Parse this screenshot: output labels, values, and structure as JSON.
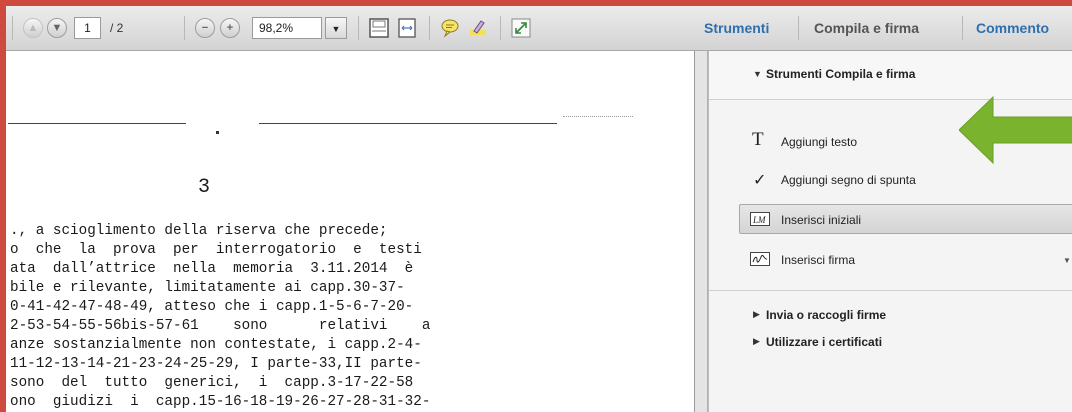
{
  "toolbar": {
    "page_current": "1",
    "page_total": "/ 2",
    "zoom": "98,2%"
  },
  "tabs": [
    {
      "label": "Strumenti",
      "color": "#2f6fae"
    },
    {
      "label": "Compila e firma",
      "color": "#555555"
    },
    {
      "label": "Commento",
      "color": "#2f6fae"
    }
  ],
  "panel": {
    "section_title": "Strumenti Compila e firma",
    "tools": [
      {
        "label": "Aggiungi testo",
        "icon": "text-t-icon"
      },
      {
        "label": "Aggiungi segno di spunta",
        "icon": "checkmark-icon"
      },
      {
        "label": "Inserisci iniziali",
        "icon": "initials-icon"
      },
      {
        "label": "Inserisci firma",
        "icon": "signature-icon"
      }
    ],
    "collapsed_sections": [
      "Invia o raccogli firme",
      "Utilizzare i certificati"
    ],
    "arrow_color": "#7ab32e"
  },
  "document": {
    "page_number": "3",
    "lines": [
      "., a scioglimento della riserva che precede;",
      "o  che  la  prova  per  interrogatorio  e  testi",
      "ata  dall’attrice  nella  memoria  3.11.2014  è",
      "bile e rilevante, limitatamente ai capp.30-37-",
      "0-41-42-47-48-49, atteso che i capp.1-5-6-7-20-",
      "2-53-54-55-56bis-57-61    sono      relativi    a",
      "anze sostanzialmente non contestate, i capp.2-4-",
      "11-12-13-14-21-23-24-25-29, I parte-33,II parte-",
      "sono  del  tutto  generici,  i  capp.3-17-22-58",
      "ono  giudizi  i  capp.15-16-18-19-26-27-28-31-32-"
    ]
  }
}
